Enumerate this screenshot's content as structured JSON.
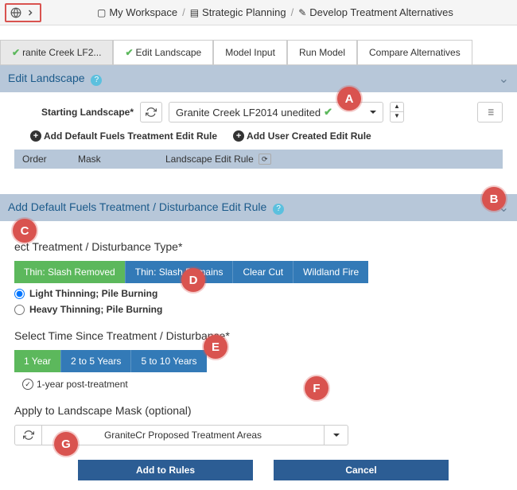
{
  "breadcrumb": {
    "item1": "My Workspace",
    "item2": "Strategic Planning",
    "item3": "Develop Treatment Alternatives"
  },
  "tabs": {
    "t1": "ranite Creek LF2...",
    "t2": "Edit Landscape",
    "t3": "Model Input",
    "t4": "Run Model",
    "t5": "Compare Alternatives"
  },
  "panel1": {
    "title": "Edit Landscape",
    "start_label": "Starting Landscape*",
    "dropdown_value": "Granite Creek LF2014 unedited",
    "add_default": "Add Default Fuels Treatment Edit Rule",
    "add_user": "Add User Created Edit Rule",
    "col_order": "Order",
    "col_mask": "Mask",
    "col_rule": "Landscape Edit Rule"
  },
  "panel2": {
    "title": "Add Default Fuels Treatment / Disturbance Edit Rule",
    "select_type": "ect Treatment / Disturbance Type*",
    "btn1": "Thin: Slash Removed",
    "btn2": "Thin: Slash Remains",
    "btn3": "Clear Cut",
    "btn4": "Wildland Fire",
    "radio1": "Light Thinning; Pile Burning",
    "radio2": "Heavy Thinning; Pile Burning",
    "select_time": "Select Time Since Treatment / Disturbance*",
    "time1": "1 Year",
    "time2": "2 to 5 Years",
    "time3": "5 to 10 Years",
    "info": "1-year post-treatment",
    "mask_title": "Apply to Landscape Mask (optional)",
    "mask_value": "GraniteCr Proposed Treatment Areas",
    "add_rules": "Add to Rules",
    "cancel": "Cancel"
  },
  "markers": {
    "a": "A",
    "b": "B",
    "c": "C",
    "d": "D",
    "e": "E",
    "f": "F",
    "g": "G"
  }
}
